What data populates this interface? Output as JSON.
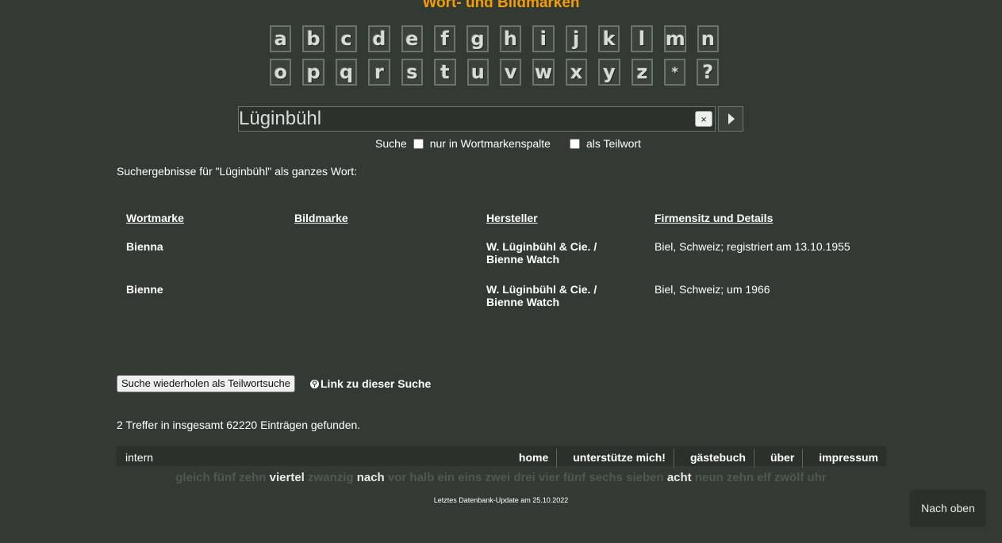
{
  "header": {
    "title": "Wort- und Bildmarken"
  },
  "alphabet": {
    "row1": [
      "a",
      "b",
      "c",
      "d",
      "e",
      "f",
      "g",
      "h",
      "i",
      "j",
      "k",
      "l",
      "m",
      "n"
    ],
    "row2": [
      "o",
      "p",
      "q",
      "r",
      "s",
      "t",
      "u",
      "v",
      "w",
      "x",
      "y",
      "z",
      "*",
      "?"
    ]
  },
  "search": {
    "value": "Lüginbühl",
    "clear_label": "×",
    "label": "Suche",
    "option1": "nur in Wortmarkenspalte",
    "option2": "als Teilwort"
  },
  "results": {
    "intro": "Suchergebnisse für \"Lüginbühl\" als ganzes Wort:",
    "columns": [
      "Wortmarke",
      "Bildmarke",
      "Hersteller",
      "Firmensitz und Details"
    ],
    "rows": [
      {
        "wortmarke": "Bienna",
        "bildmarke": "",
        "hersteller": "W. Lüginbühl & Cie. / Bienne Watch",
        "details": "Biel, Schweiz; registriert am 13.10.1955"
      },
      {
        "wortmarke": "Bienne",
        "bildmarke": "",
        "hersteller": "W. Lüginbühl & Cie. / Bienne Watch",
        "details": "Biel, Schweiz; um 1966"
      }
    ]
  },
  "actions": {
    "repeat_label": "Suche wiederholen als Teilwortsuche",
    "link_label": "Link zu dieser Suche"
  },
  "hits_text": "2 Treffer in insgesamt 62220 Einträgen gefunden.",
  "footer": {
    "intern": "intern",
    "nav": [
      "home",
      "unterstütze mich!",
      "gästebuch",
      "über",
      "impressum"
    ]
  },
  "clock_words": [
    {
      "w": "gleich",
      "on": false
    },
    {
      "w": "fünf",
      "on": false
    },
    {
      "w": "zehn",
      "on": false
    },
    {
      "w": "viertel",
      "on": true
    },
    {
      "w": "zwanzig",
      "on": false
    },
    {
      "w": "nach",
      "on": true
    },
    {
      "w": "vor",
      "on": false
    },
    {
      "w": "halb",
      "on": false
    },
    {
      "w": "ein",
      "on": false
    },
    {
      "w": "eins",
      "on": false
    },
    {
      "w": "zwei",
      "on": false
    },
    {
      "w": "drei",
      "on": false
    },
    {
      "w": "vier",
      "on": false
    },
    {
      "w": "fünf",
      "on": false
    },
    {
      "w": "sechs",
      "on": false
    },
    {
      "w": "sieben",
      "on": false
    },
    {
      "w": "acht",
      "on": true
    },
    {
      "w": "neun",
      "on": false
    },
    {
      "w": "zehn",
      "on": false
    },
    {
      "w": "elf",
      "on": false
    },
    {
      "w": "zwölf",
      "on": false
    },
    {
      "w": "uhr",
      "on": false
    }
  ],
  "update_text": "Letztes Datenbank-Update am 25.10.2022",
  "back_to_top": "Nach oben"
}
